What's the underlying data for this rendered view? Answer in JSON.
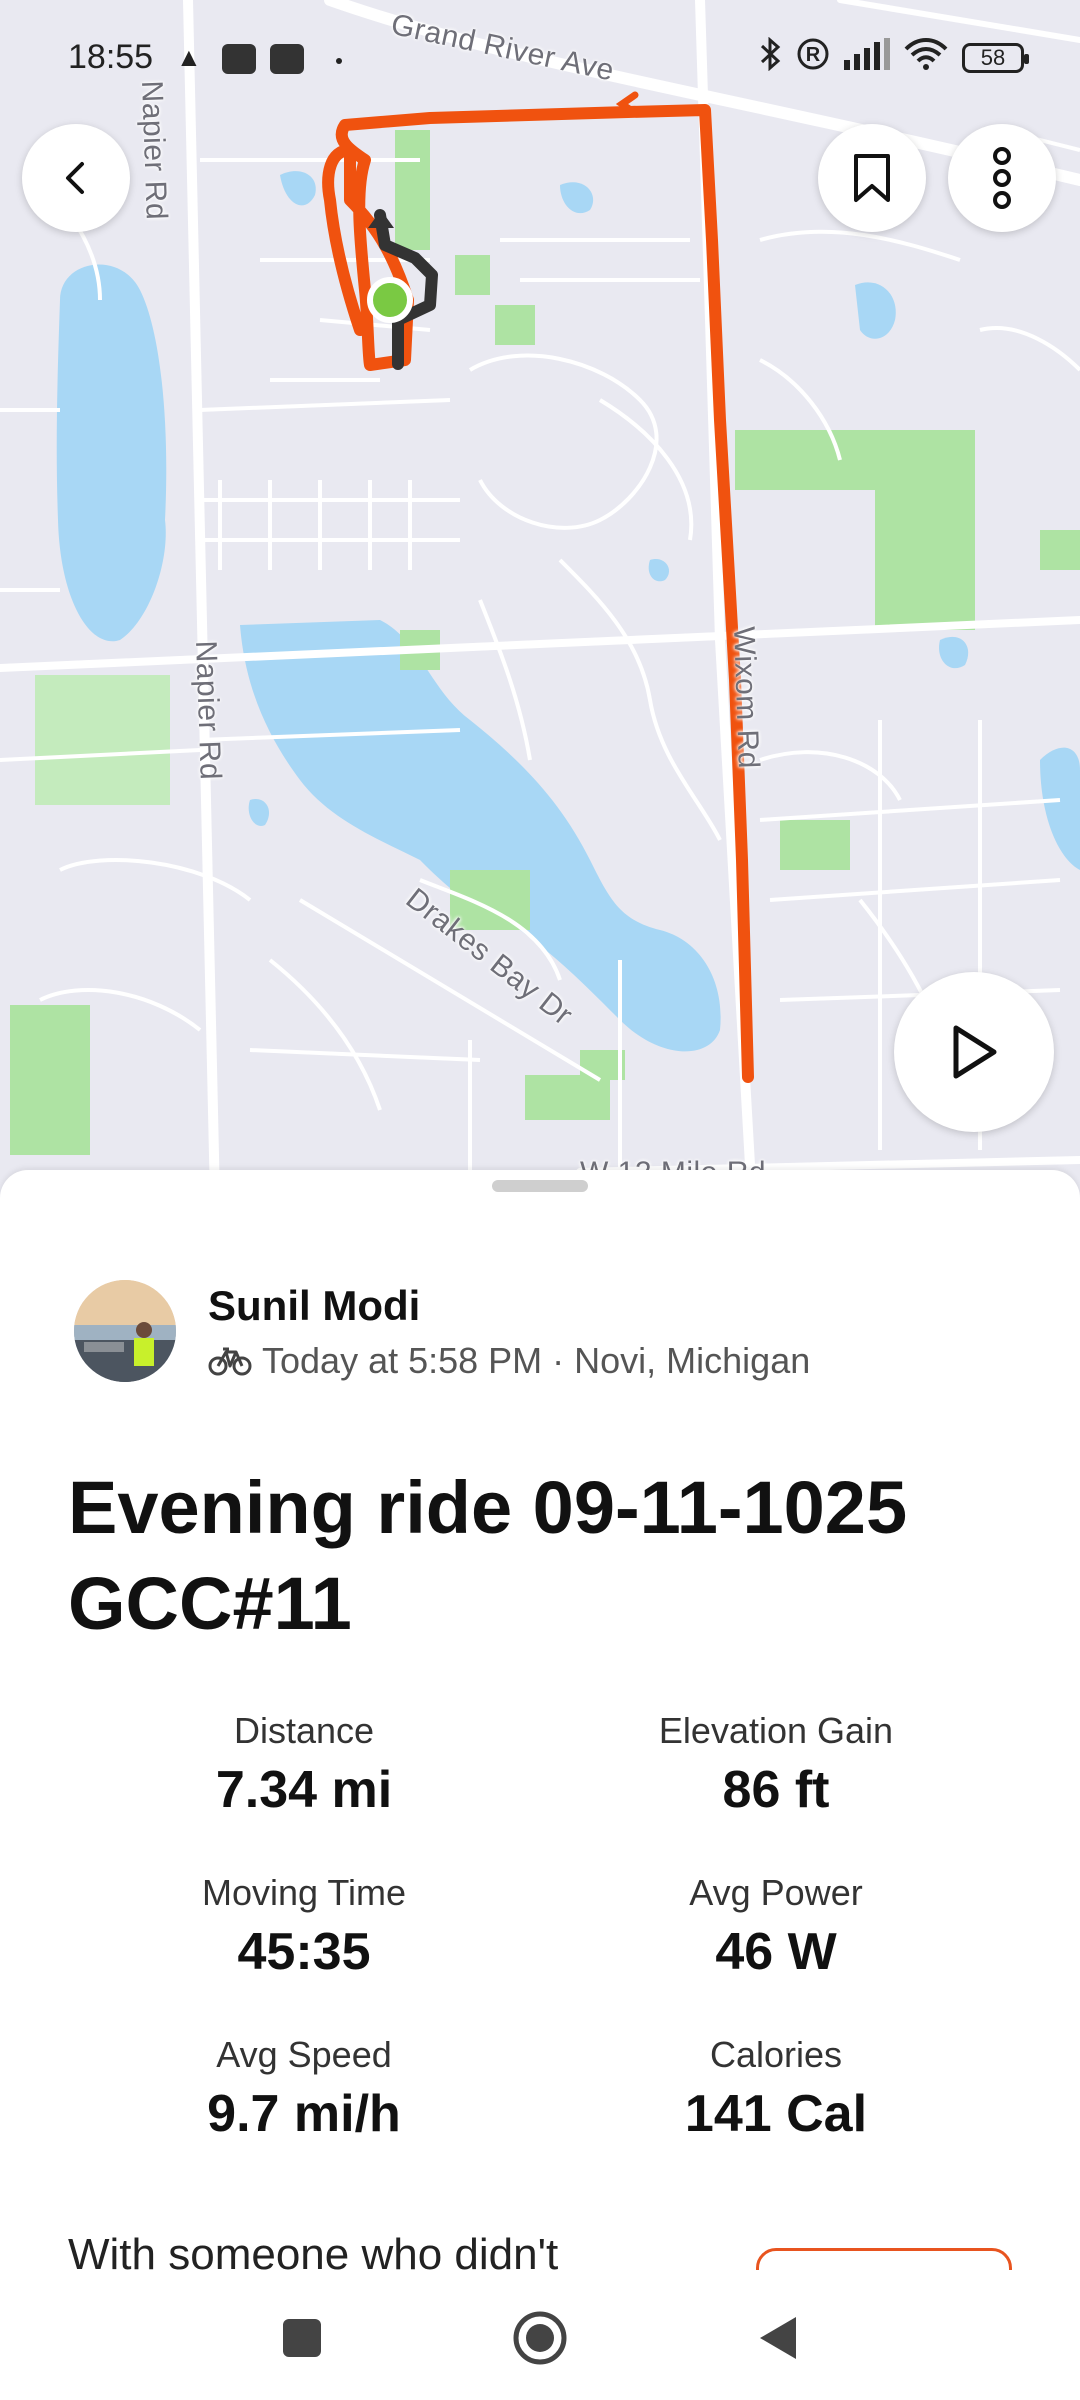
{
  "status_bar": {
    "time": "18:55",
    "battery": "58",
    "icons": [
      "navigation-arrow-icon",
      "notification-icon",
      "notification-icon",
      "bluetooth-icon",
      "registered-icon",
      "signal-icon",
      "wifi-icon",
      "battery-icon"
    ]
  },
  "map": {
    "road_labels": {
      "grand_river": "Grand River Ave",
      "napier_top": "Napier Rd",
      "napier_mid": "Napier Rd",
      "wixom": "Wixom Rd",
      "drakes_bay": "Drakes Bay Dr",
      "twelve_mile": "W 12 Mile Rd"
    },
    "route_color": "#f0520f",
    "water_color": "#a8d7f5",
    "park_color": "#aee3a3"
  },
  "buttons": {
    "back": "chevron-left-icon",
    "bookmark": "bookmark-icon",
    "more": "more-vertical-icon",
    "play": "play-icon"
  },
  "activity": {
    "athlete": "Sunil Modi",
    "meta": "Today at 5:58 PM · Novi, Michigan",
    "title": "Evening ride 09-11-1025 GCC#11",
    "stats": [
      {
        "label": "Distance",
        "value": "7.34 mi"
      },
      {
        "label": "Elevation Gain",
        "value": "86 ft"
      },
      {
        "label": "Moving Time",
        "value": "45:35"
      },
      {
        "label": "Avg Power",
        "value": "46 W"
      },
      {
        "label": "Avg Speed",
        "value": "9.7 mi/h"
      },
      {
        "label": "Calories",
        "value": "141 Cal"
      }
    ],
    "partial_text": "With someone who didn't"
  },
  "nav": [
    "recent-apps-icon",
    "home-icon",
    "back-icon"
  ]
}
